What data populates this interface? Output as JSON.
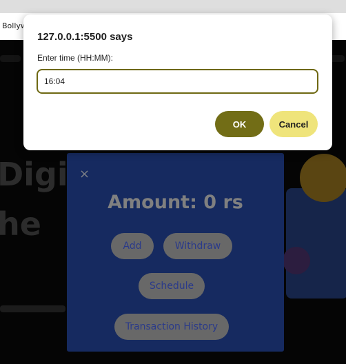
{
  "browser": {
    "bookmark_label": "Bollyw"
  },
  "page": {
    "hero_line_1": "Digit",
    "hero_line_2": "he"
  },
  "modal": {
    "close_glyph": "×",
    "amount_text": "Amount: 0 rs",
    "buttons": {
      "add": "Add",
      "withdraw": "Withdraw",
      "schedule": "Schedule",
      "history": "Transaction History"
    }
  },
  "dialog": {
    "title": "127.0.0.1:5500 says",
    "message": "Enter time (HH:MM):",
    "input_value": "16:04",
    "ok_label": "OK",
    "cancel_label": "Cancel"
  },
  "colors": {
    "accent": "#726d16",
    "cancel": "#efe47b",
    "modal_bg": "#162a60"
  }
}
